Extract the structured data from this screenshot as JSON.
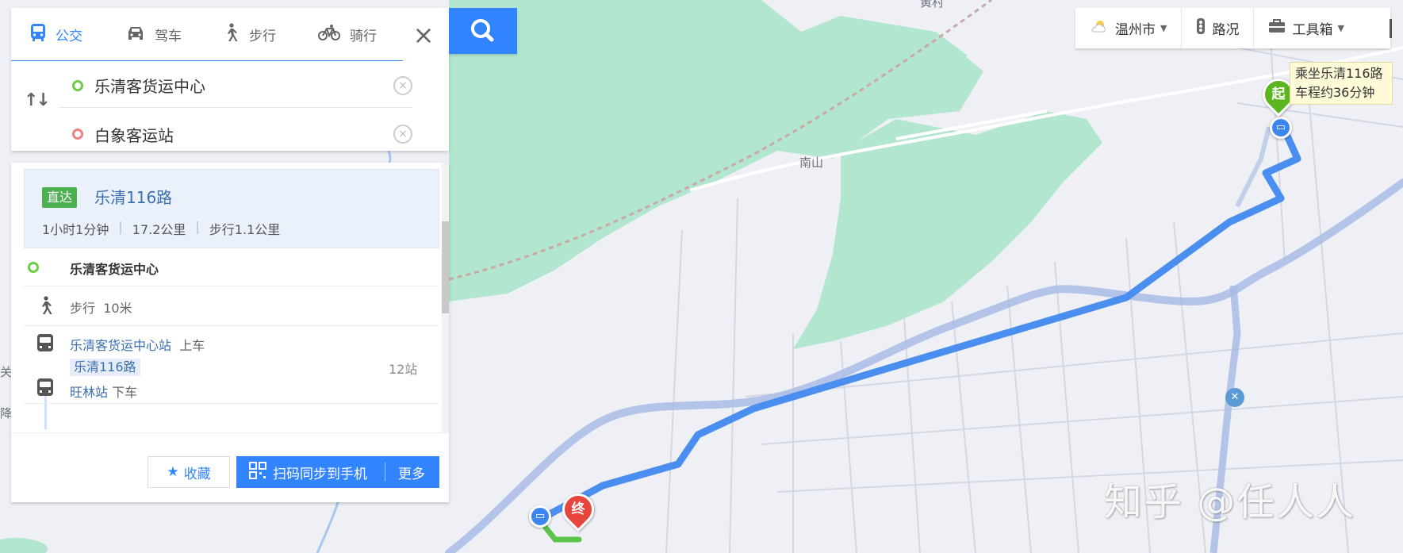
{
  "modes": [
    {
      "label": "公交",
      "icon": "bus-icon",
      "active": true
    },
    {
      "label": "驾车",
      "icon": "car-icon",
      "active": false
    },
    {
      "label": "步行",
      "icon": "walk-icon",
      "active": false
    },
    {
      "label": "骑行",
      "icon": "bike-icon",
      "active": false
    }
  ],
  "route_inputs": {
    "start": "乐清客货运中心",
    "end": "白象客运站"
  },
  "route": {
    "badge": "直达",
    "name": "乐清116路",
    "duration": "1小时1分钟",
    "distance": "17.2公里",
    "walk": "步行1.1公里"
  },
  "steps": {
    "start_name": "乐清客货运中心",
    "walk_label": "步行",
    "walk_distance": "10米",
    "board_station": "乐清客货运中心站",
    "board_action": "上车",
    "line_tag": "乐清116路",
    "stop_count": "12站",
    "alight_station": "旺林站",
    "alight_action": "下车"
  },
  "actions": {
    "favorite": "收藏",
    "sync": "扫码同步到手机",
    "more": "更多"
  },
  "toolbar": {
    "city": "温州市",
    "traffic": "路况",
    "tools": "工具箱"
  },
  "map": {
    "tooltip_line1": "乘坐乐清116路",
    "tooltip_line2": "车程约36分钟",
    "start_pin": "起",
    "end_pin": "终",
    "place_nanshan": "南山",
    "place_top": "黄村",
    "edge_label_1": "关当",
    "edge_label_2": "降",
    "watermark": "知乎 @任人人"
  },
  "colors": {
    "accent": "#3385ff",
    "route_line": "#4a8ff0",
    "start_pin": "#5cb51f",
    "end_pin": "#e8453c",
    "park": "#b2e6cf"
  }
}
